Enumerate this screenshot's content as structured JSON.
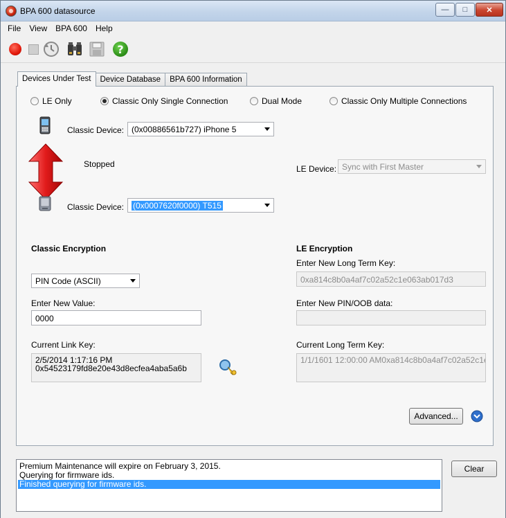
{
  "window": {
    "title": "BPA 600 datasource"
  },
  "menu": [
    {
      "label": "File"
    },
    {
      "label": "View"
    },
    {
      "label": "BPA 600"
    },
    {
      "label": "Help"
    }
  ],
  "tabs": [
    {
      "label": "Devices Under Test",
      "active": true
    },
    {
      "label": "Device Database",
      "active": false
    },
    {
      "label": "BPA 600 Information",
      "active": false
    }
  ],
  "mode_options": [
    {
      "label": "LE Only",
      "selected": false
    },
    {
      "label": "Classic Only Single Connection",
      "selected": true
    },
    {
      "label": "Dual Mode",
      "selected": false
    },
    {
      "label": "Classic Only Multiple Connections",
      "selected": false
    }
  ],
  "classic_device_1": {
    "label": "Classic Device:",
    "value": "(0x00886561b727) iPhone 5"
  },
  "status": "Stopped",
  "le_device": {
    "label": "LE Device:",
    "value": "Sync with First Master"
  },
  "classic_device_2": {
    "label": "Classic Device:",
    "value": "(0x0007620f0000) T515"
  },
  "classic_encryption": {
    "heading": "Classic Encryption",
    "pin_type": "PIN Code (ASCII)",
    "new_value_label": "Enter New Value:",
    "new_value": "0000",
    "current_key_label": "Current Link Key:",
    "current_key_line1": "2/5/2014 1:17:16 PM",
    "current_key_line2": "0x54523179fd8e20e43d8ecfea4aba5a6b"
  },
  "le_encryption": {
    "heading": "LE Encryption",
    "ltk_label": "Enter New Long Term Key:",
    "ltk_value": "0xa814c8b0a4af7c02a52c1e063ab017d3",
    "pin_oob_label": "Enter New PIN/OOB data:",
    "pin_oob_value": "",
    "current_ltk_label": "Current Long Term Key:",
    "current_ltk_value": "1/1/1601 12:00:00 AM0xa814c8b0a4af7c02a52c1e"
  },
  "advanced_button": "Advanced...",
  "log_lines": [
    "Premium Maintenance will expire on February 3, 2015.",
    "Querying for firmware ids.",
    "Finished querying for firmware ids."
  ],
  "clear_button": "Clear"
}
